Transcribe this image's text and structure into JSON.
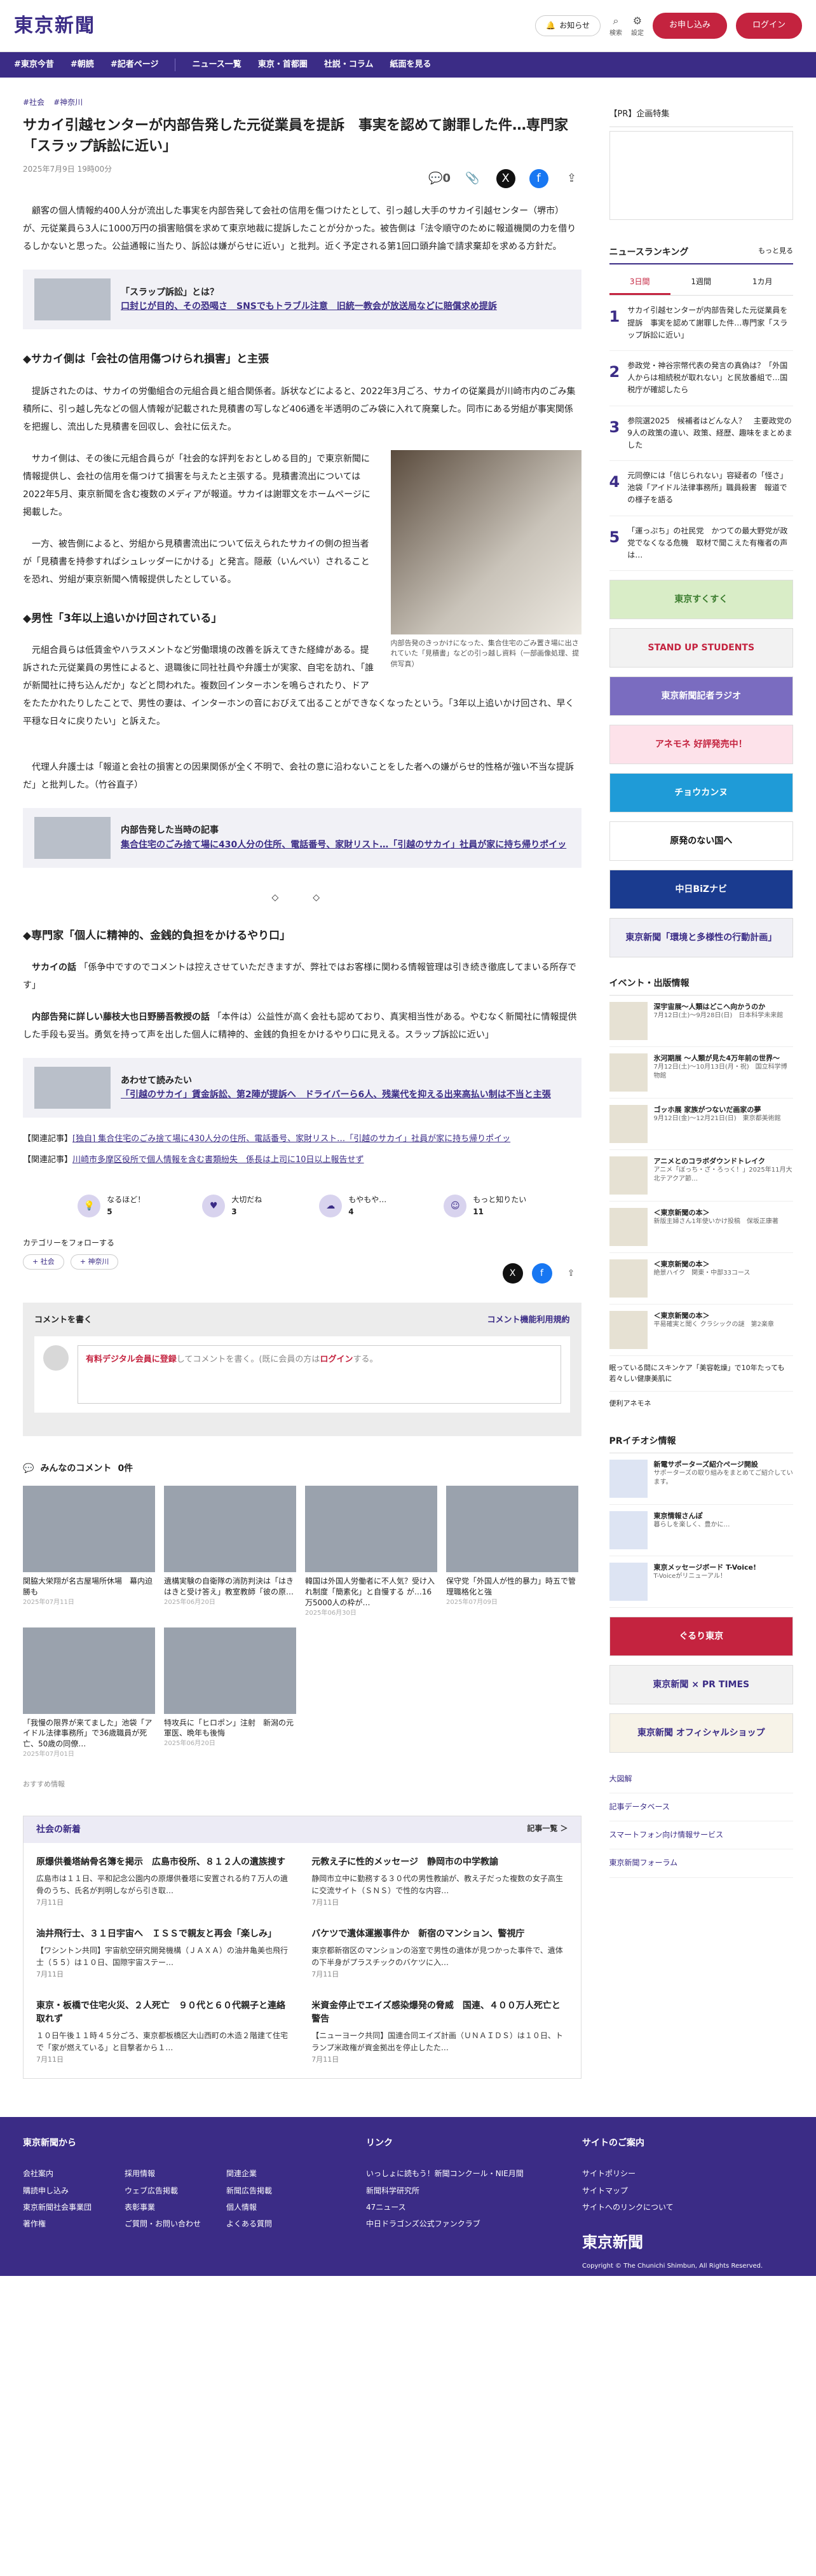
{
  "header": {
    "logo": "東京新聞",
    "notice": "お知らせ",
    "search": "検索",
    "settings": "設定",
    "subscribe": "お申し込み",
    "login": "ログイン"
  },
  "nav": [
    "#東京今昔",
    "#朝読",
    "#記者ページ",
    "ニュース一覧",
    "東京・首都圏",
    "社説・コラム",
    "紙面を見る"
  ],
  "article": {
    "tags": [
      "#社会",
      "#神奈川"
    ],
    "title": "サカイ引越センターが内部告発した元従業員を提訴　事実を認めて謝罪した件…専門家「スラップ訴訟に近い」",
    "date": "2025年7月9日 19時00分",
    "comment_count": "0",
    "lead": "顧客の個人情報約400人分が流出した事実を内部告発して会社の信用を傷つけたとして、引っ越し大手のサカイ引越センター（堺市）が、元従業員ら3人に1000万円の損害賠償を求めて東京地裁に提訴したことが分かった。被告側は「法令順守のために報道機関の力を借りるしかないと思った。公益通報に当たり、訴訟は嫌がらせに近い」と批判。近く予定される第1回口頭弁論で請求棄却を求める方針だ。",
    "box1": {
      "title": "「スラップ訴訟」とは？",
      "link": "口封じが目的、その恐喝さ　SNSでもトラブル注意　旧統一教会が放送局などに賠償求め提訴"
    },
    "h2a": "◆サカイ側は「会社の信用傷つけられ損害」と主張",
    "p1": "提訴されたのは、サカイの労働組合の元組合員と組合関係者。訴状などによると、2022年3月ごろ、サカイの従業員が川崎市内のごみ集積所に、引っ越し先などの個人情報が記載された見積書の写しなど406通を半透明のごみ袋に入れて廃棄した。同市にある労組が事実関係を把握し、流出した見積書を回収し、会社に伝えた。",
    "p2": "サカイ側は、その後に元組合員らが「社会的な評判をおとしめる目的」で東京新聞に情報提供し、会社の信用を傷つけて損害を与えたと主張する。見積書流出については2022年5月、東京新聞を含む複数のメディアが報道。サカイは謝罪文をホームページに掲載した。",
    "p3": "一方、被告側によると、労組から見積書流出について伝えられたサカイの側の担当者が「見積書を持参すればシュレッダーにかける」と発言。隠蔽（いんぺい）されることを恐れ、労組が東京新聞へ情報提供したとしている。",
    "photo_caption": "内部告発のきっかけになった、集合住宅のごみ置き場に出されていた「見積書」などの引っ越し資料（一部画像処理、提供写真）",
    "h2b": "◆男性「3年以上追いかけ回されている」",
    "p4": "元組合員らは低賃金やハラスメントなど労働環境の改善を訴えてきた経緯がある。提訴された元従業員の男性によると、退職後に同社社員や弁護士が実家、自宅を訪れ、「誰が新聞社に持ち込んだか」などと問われた。複数回インターホンを鳴らされたり、ドアをたたかれたりしたことで、男性の妻は、インターホンの音におびえて出ることができなくなったという。「3年以上追いかけ回され、早く平穏な日々に戻りたい」と訴えた。",
    "p5": "代理人弁護士は「報道と会社の損害との因果関係が全く不明で、会社の意に沿わないことをした者への嫌がらせ的性格が強い不当な提訴だ」と批判した。（竹谷直子）",
    "box2": {
      "title": "内部告発した当時の記事",
      "link": "集合住宅のごみ捨て場に430人分の住所、電話番号、家財リスト…「引越のサカイ」社員が家に持ち帰りポイッ"
    },
    "dots": "◇　◇",
    "h2c": "◆専門家「個人に精神的、金銭的負担をかけるやり口」",
    "p6a": "サカイの話",
    "p6": "「係争中ですのでコメントは控えさせていただきますが、弊社ではお客様に関わる情報管理は引き続き徹底してまいる所存です」",
    "p7a": "内部告発に詳しい藤枝大也日野勝吾教授の話",
    "p7": "「本件は）公益性が高く会社も認めており、真実相当性がある。やむなく新聞社に情報提供した手段も妥当。勇気を持って声を出した個人に精神的、金銭的負担をかけるやり口に見える。スラップ訴訟に近い」",
    "box3": {
      "title": "あわせて読みたい",
      "link": "「引越のサカイ」賃金訴訟、第2陣が提訴へ　ドライバーら6人、残業代を抑える出来高払い制は不当と主張"
    },
    "rel1_label": "【関連記事】",
    "rel1": "[独自] 集合住宅のごみ捨て場に430人分の住所、電話番号、家財リスト…「引越のサカイ」社員が家に持ち帰りポイッ",
    "rel2_label": "【関連記事】",
    "rel2": "川崎市多摩区役所で個人情報を含む書類紛失　係長は上司に10日以上報告せず"
  },
  "reactions": [
    {
      "label": "なるほど！",
      "count": "5"
    },
    {
      "label": "大切だね",
      "count": "3"
    },
    {
      "label": "もやもや…",
      "count": "4"
    },
    {
      "label": "もっと知りたい",
      "count": "11"
    }
  ],
  "follow": {
    "heading": "カテゴリーをフォローする",
    "chips": [
      "社会",
      "神奈川"
    ]
  },
  "comment": {
    "heading": "コメントを書く",
    "rules": "コメント機能利用規約",
    "pre": "有料デジタル会員に登録",
    "mid": "してコメントを書く。(既に会員の方は",
    "login": "ログイン",
    "post": "する。"
  },
  "my_comments": {
    "title": "みんなのコメント",
    "count": "0件"
  },
  "cards": [
    {
      "title": "関脇大栄翔が名古屋場所休場　幕内迫勝も",
      "date": "2025年07月11日"
    },
    {
      "title": "遺構実験の自衛隊の消防判決は「はきはきと受け答え」教室教師「彼の原…",
      "date": "2025年06月20日"
    },
    {
      "title": "韓国は外国人労働者に不人気？受け入れ制度「簡素化」と自慢する が…16万5000人の枠が…",
      "date": "2025年06月30日"
    },
    {
      "title": "保守党「外国人が性的暴力」時五で管理職格化と強",
      "date": "2025年07月09日"
    },
    {
      "title": "「我慢の限界が来てました」池袋「アイドル法律事務所」で36歳職員が死亡、50歳の同僚…",
      "date": "2025年07月01日"
    },
    {
      "title": "特攻兵に「ヒロポン」注射　新潟の元軍医、晩年も後悔",
      "date": "2025年06月20日"
    }
  ],
  "recommend": "おすすめ情報",
  "social": {
    "heading": "社会の新着",
    "more": "記事一覧 ＞",
    "items": [
      {
        "title": "原爆供養塔納骨名簿を掲示　広島市役所、８１２人の遺族捜す",
        "desc": "広島市は１１日、平和記念公園内の原爆供養塔に安置される約７万人の遺骨のうち、氏名が判明しながら引き取…",
        "date": "7月11日"
      },
      {
        "title": "元教え子に性的メッセージ　静岡市の中学教諭",
        "desc": "静岡市立中に勤務する３０代の男性教諭が、教え子だった複数の女子高生に交流サイト（ＳＮＳ）で性的な内容…",
        "date": "7月11日"
      },
      {
        "title": "油井飛行士、３１日宇宙へ　ＩＳＳで親友と再会「楽しみ」",
        "desc": "【ワシントン共同】宇宙航空研究開発機構（ＪＡＸＡ）の油井亀美也飛行士（５５）は１０日、国際宇宙ステー…",
        "date": "7月11日"
      },
      {
        "title": "バケツで遺体運搬事件か　新宿のマンション、警視庁",
        "desc": "東京都新宿区のマンションの浴室で男性の遺体が見つかった事件で、遺体の下半身がプラスチックのバケツに入…",
        "date": "7月11日"
      },
      {
        "title": "東京・板橋で住宅火災、２人死亡　９０代と６０代親子と連絡取れず",
        "desc": "１０日午後１１時４５分ごろ、東京都板橋区大山西町の木造２階建て住宅で「家が燃えている」と目撃者から１…",
        "date": "7月11日"
      },
      {
        "title": "米資金停止でエイズ感染爆発の脅威　国連、４００万人死亡と警告",
        "desc": "【ニューヨーク共同】国連合同エイズ計画（ＵＮＡＩＤＳ）は１０日、トランプ米政権が資金拠出を停止したた…",
        "date": "7月11日"
      }
    ]
  },
  "side": {
    "pr": "【PR】企画特集",
    "ranking_title": "ニュースランキング",
    "ranking_more": "もっと見る",
    "tabs": [
      "3日間",
      "1週間",
      "1カ月"
    ],
    "ranking": [
      {
        "n": "1",
        "t": "サカイ引越センターが内部告発した元従業員を提訴　事実を認めて謝罪した件…専門家「スラップ訴訟に近い」"
      },
      {
        "n": "2",
        "t": "参政党・神谷宗幣代表の発言の真偽は？「外国人からは相続税が取れない」と民放番組で…国税庁が確認したら"
      },
      {
        "n": "3",
        "t": "参院選2025　候補者はどんな人？　主要政党の9人の政策の違い、政策、経歴、趣味をまとめました"
      },
      {
        "n": "4",
        "t": "元同僚には「信じられない」容疑者の「怪さ」池袋「アイドル法律事務所」職員殺害　報道での様子を語る"
      },
      {
        "n": "5",
        "t": "「運っぷち」の社民党　かつての最大野党が政党でなくなる危機　取材で聞こえた有権者の声は…"
      }
    ],
    "banners": [
      {
        "label": "東京すくすく",
        "bg": "#d9edc7",
        "fg": "#3c7d2f"
      },
      {
        "label": "STAND UP STUDENTS",
        "bg": "#f2f2f2",
        "fg": "#c4233f"
      },
      {
        "label": "東京新聞記者ラジオ",
        "bg": "#7a6cc0",
        "fg": "#ffffff"
      },
      {
        "label": "アネモネ 好評発売中！",
        "bg": "#fde2ea",
        "fg": "#c4233f"
      },
      {
        "label": "チョウカンヌ",
        "bg": "#1f9bd7",
        "fg": "#ffffff"
      },
      {
        "label": "原発のない国へ",
        "bg": "#ffffff",
        "fg": "#111111"
      },
      {
        "label": "中日BiZナビ",
        "bg": "#1a3b8f",
        "fg": "#ffffff"
      },
      {
        "label": "東京新聞「環境と多様性の行動計画」",
        "bg": "#f0f0f5",
        "fg": "#3b2c86"
      }
    ],
    "events_title": "イベント・出版情報",
    "events": [
      {
        "t": "深宇宙展〜人類はどこへ向かうのか",
        "d": "7月12日(土)〜9月28日(日)　日本科学未来館"
      },
      {
        "t": "氷河期展 〜人類が見た4万年前の世界〜",
        "d": "7月12日(土)〜10月13日(月・祝)　国立科学博物館"
      },
      {
        "t": "ゴッホ展 家族がつないだ画家の夢",
        "d": "9月12日(金)〜12月21日(日)　東京都美術館"
      },
      {
        "t": "アニメとのコラボダウンドトレイク",
        "d": "アニメ「ぼっち・ざ・ろっく！」2025年11月大北テアクア節…"
      },
      {
        "t": "＜東京新聞の本＞",
        "d": "新版主婦さん1年使いかけ投稿　保坂正康著"
      },
      {
        "t": "＜東京新聞の本＞",
        "d": "絶景ハイク　関東・中部33コース"
      },
      {
        "t": "＜東京新聞の本＞",
        "d": "平易確実と聞く クラシックの謎　第2楽章"
      }
    ],
    "events_more1": "眠っている間にスキンケア「美容乾燥」で10年たっても若々しい健康美肌に",
    "events_more2": "便利アネモネ",
    "pr2_title": "PRイチオシ情報",
    "pr2": [
      {
        "t": "新電サポーターズ紹介ページ開設",
        "d": "サポーターズの取り組みをまとめてご紹介しています。"
      },
      {
        "t": "東京情報さんぽ",
        "d": "暮らしを楽しく、豊かに…"
      },
      {
        "t": "東京メッセージボード T-Voice!",
        "d": "T-Voiceがリニューアル！"
      }
    ],
    "banners2": [
      {
        "label": "ぐるり東京",
        "bg": "#c4233f",
        "fg": "#ffffff"
      },
      {
        "label": "東京新聞 × PR TIMES",
        "bg": "#f2f2f2",
        "fg": "#3b2c86"
      },
      {
        "label": "東京新聞 オフィシャルショップ",
        "bg": "#f7f3e8",
        "fg": "#3b2c86"
      }
    ],
    "links": [
      "大図解",
      "記事データベース",
      "スマートフォン向け情報サービス",
      "東京新聞フォーラム"
    ]
  },
  "footer": {
    "col1_title": "東京新聞から",
    "col1": [
      "会社案内",
      "採用情報",
      "関連企業",
      "購読申し込み",
      "ウェブ広告掲載",
      "新聞広告掲載",
      "東京新聞社会事業団",
      "表彰事業",
      "個人情報",
      "著作権",
      "ご質問・お問い合わせ",
      "よくある質問"
    ],
    "col2_title": "リンク",
    "col2": [
      "いっしょに読もう！新聞コンクール・NIE月間",
      "新聞科学研究所",
      "47ニュース",
      "中日ドラゴンズ公式ファンクラブ"
    ],
    "col3_title": "サイトのご案内",
    "col3": [
      "サイトポリシー",
      "サイトマップ",
      "サイトへのリンクについて"
    ],
    "logo": "東京新聞",
    "copyright": "Copyright © The Chunichi Shimbun, All Rights Reserved."
  }
}
